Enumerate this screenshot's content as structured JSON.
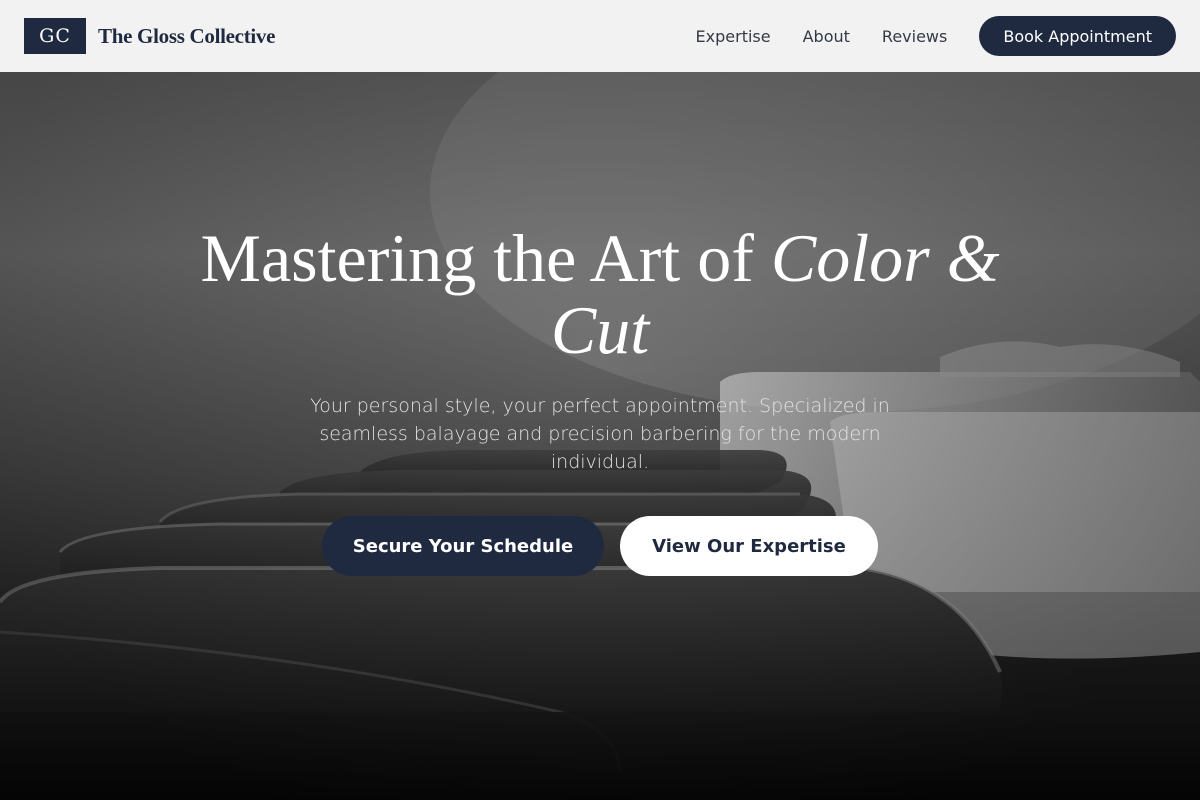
{
  "header": {
    "logo_text": "GC",
    "brand_name": "The Gloss Collective",
    "nav": [
      {
        "label": "Expertise"
      },
      {
        "label": "About"
      },
      {
        "label": "Reviews"
      }
    ],
    "book_button": "Book Appointment"
  },
  "hero": {
    "headline_plain": "Mastering the Art of ",
    "headline_italic": "Color & Cut",
    "subtitle": "Your personal style, your perfect appointment. Specialized in seamless balayage and precision barbering for the modern individual.",
    "primary_cta": "Secure Your Schedule",
    "secondary_cta": "View Our Expertise",
    "background_image": "salon-chairs-photo"
  },
  "colors": {
    "brand_navy": "#1f2a40",
    "header_bg": "#f2f2f2",
    "white": "#ffffff"
  }
}
